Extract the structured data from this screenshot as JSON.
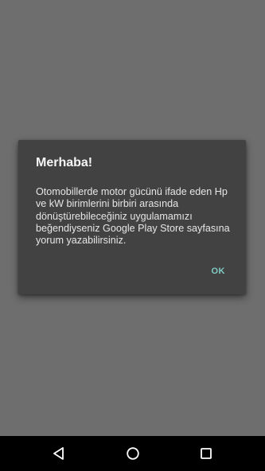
{
  "dialog": {
    "title": "Merhaba!",
    "message": "Otomobillerde motor gücünü ifade eden Hp ve kW birimlerini birbiri arasında dönüştürebileceğiniz uygulamamızı beğendiyseniz Google Play Store sayfasına yorum yazabilirsiniz.",
    "ok_label": "OK"
  },
  "navbar": {
    "back_icon": "back-triangle-icon",
    "home_icon": "home-circle-icon",
    "recent_icon": "recent-apps-square-icon"
  },
  "colors": {
    "scrim": "#6e6e6e",
    "dialog_bg": "#424242",
    "accent": "#80cbc4",
    "navbar_bg": "#000000"
  }
}
